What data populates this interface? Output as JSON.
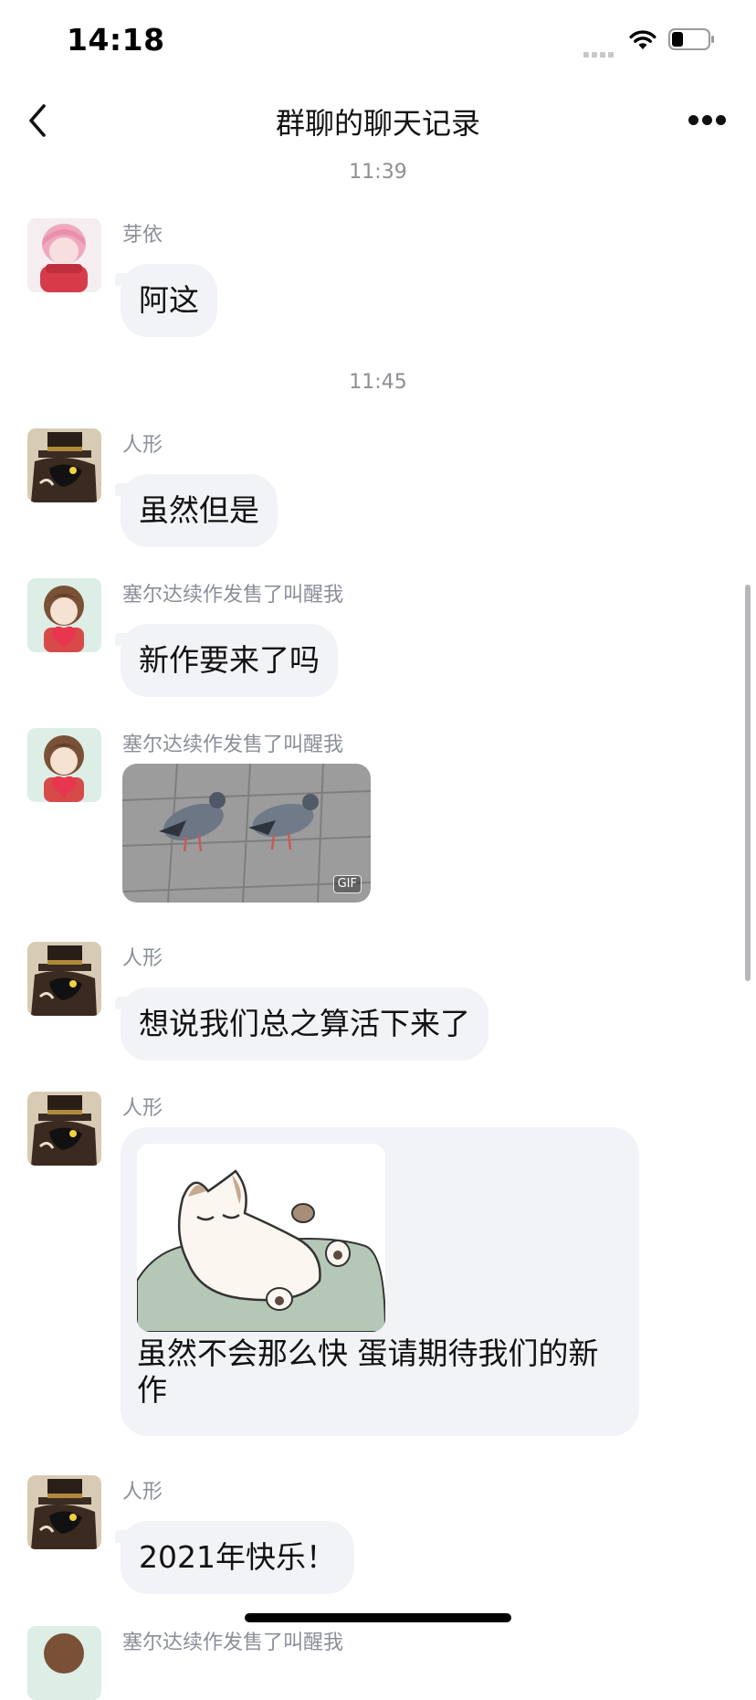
{
  "status_bar": {
    "time": "14:18"
  },
  "nav": {
    "title": "群聊的聊天记录"
  },
  "timestamps": [
    "11:39",
    "11:45"
  ],
  "messages": [
    {
      "sender": "芽依",
      "text": "阿这",
      "avatar": "pink-hair-avatar-icon"
    },
    {
      "sender": "人形",
      "text": "虽然但是",
      "avatar": "dark-creature-top-hat-avatar-icon"
    },
    {
      "sender": "塞尔达续作发售了叫醒我",
      "text": "新作要来了吗",
      "avatar": "brown-hair-heart-avatar-icon"
    },
    {
      "sender": "塞尔达续作发售了叫醒我",
      "image": "pigeons-gif",
      "badge": "GIF",
      "avatar": "brown-hair-heart-avatar-icon"
    },
    {
      "sender": "人形",
      "text": "想说我们总之算活下来了",
      "avatar": "dark-creature-top-hat-avatar-icon"
    },
    {
      "sender": "人形",
      "image": "cat-sticker",
      "text_line1": "虽然不会那么快 蛋请期待我们的新",
      "text_line2": "作",
      "avatar": "dark-creature-top-hat-avatar-icon"
    },
    {
      "sender": "人形",
      "text": "2021年快乐！",
      "avatar": "dark-creature-top-hat-avatar-icon"
    },
    {
      "sender": "塞尔达续作发售了叫醒我",
      "avatar": "brown-hair-heart-avatar-icon"
    }
  ]
}
